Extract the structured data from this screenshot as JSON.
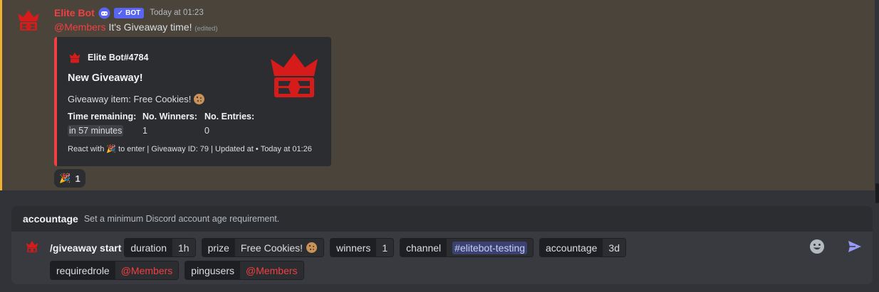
{
  "message": {
    "author": "Elite Bot",
    "bot_tag": "BOT",
    "timestamp": "Today at 01:23",
    "mention": "@Members",
    "text": "It's Giveaway time!",
    "edited": "(edited)",
    "accent_color": "#f0b232",
    "embed": {
      "author": "Elite Bot#4784",
      "title": "New Giveaway!",
      "description": "Giveaway item: Free Cookies!",
      "color": "#f23f42",
      "fields": [
        {
          "name": "Time remaining:",
          "value": "in 57 minutes"
        },
        {
          "name": "No. Winners:",
          "value": "1"
        },
        {
          "name": "No. Entries:",
          "value": "0"
        }
      ],
      "footer_prefix": "React with",
      "footer_suffix": "to enter | Giveaway ID: 79 | Updated at",
      "footer_time": "Today at 01:26"
    },
    "reaction": {
      "emoji": "tada-icon",
      "count": "1"
    }
  },
  "command_hint": {
    "name": "accountage",
    "description": "Set a minimum Discord account age requirement."
  },
  "composer": {
    "command": "/giveaway start",
    "options": [
      {
        "key": "duration",
        "value": "1h"
      },
      {
        "key": "prize",
        "value": "Free Cookies!"
      },
      {
        "key": "winners",
        "value": "1"
      },
      {
        "key": "channel",
        "value": "#elitebot-testing"
      },
      {
        "key": "accountage",
        "value": "3d"
      },
      {
        "key": "requiredrole",
        "value": "@Members"
      },
      {
        "key": "pingusers",
        "value": "@Members"
      }
    ]
  }
}
